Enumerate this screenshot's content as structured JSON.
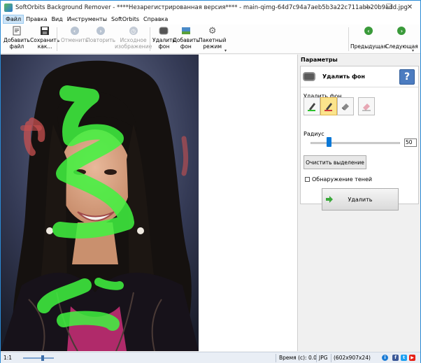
{
  "window": {
    "title": "SoftOrbits Background Remover - ****Незарегистрированная версия**** - main-qimg-64d7c94a7aeb5b3a22c711abb20b9add.jpg",
    "minimize_glyph": "—",
    "maximize_glyph": "☐",
    "close_glyph": "✕"
  },
  "menu": {
    "items": [
      "Файл",
      "Правка",
      "Вид",
      "Инструменты",
      "SoftOrbits",
      "Справка"
    ]
  },
  "toolbar": {
    "add_file": "Добавить\nфайл",
    "save_as": "Сохранить\nкак...",
    "undo": "Отменить",
    "redo": "Повторить",
    "original": "Исходное\nизображение",
    "remove_bg": "Удалить\nфон",
    "add_bg": "Добавить\nфон",
    "batch": "Пакетный\nрежим",
    "previous": "Предыдущая",
    "next": "Следующая"
  },
  "panel": {
    "title": "Параметры",
    "remove_bg_title": "Удалить фон",
    "help_glyph": "?",
    "remove_bg_label": "Удалить фон",
    "radius_label": "Радиус",
    "radius_value": "50",
    "radius_fraction": 0.2,
    "clear_selection": "Очистить выделение",
    "shadow_detection": "Обнаружение теней",
    "delete_button": "Удалить"
  },
  "status": {
    "zoom_label": "1:1",
    "time": "Время (с): 0.0",
    "format": "JPG",
    "dimensions": "(602x907x24)"
  },
  "colors": {
    "accent": "#2b8bd6",
    "green_marker": "#3ff53f",
    "red_marker": "#c85050",
    "nav_green": "#3a9a3a"
  }
}
